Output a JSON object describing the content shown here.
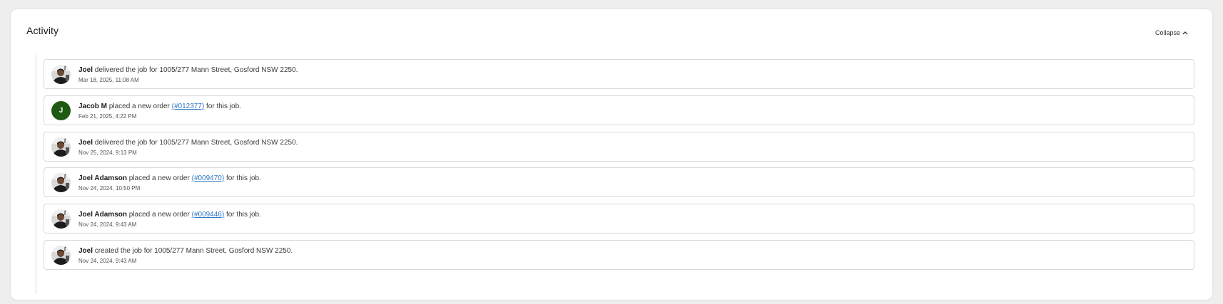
{
  "activity": {
    "title": "Activity",
    "collapse_label": "Collapse",
    "items": [
      {
        "actor": "Joel",
        "avatar_type": "photo",
        "action": "delivered the job for 1005/277 Mann Street, Gosford NSW 2250.",
        "link": "",
        "suffix": "",
        "timestamp": "Mar 18, 2025, 11:08 AM"
      },
      {
        "actor": "Jacob M",
        "avatar_type": "initial",
        "avatar_initial": "J",
        "avatar_color": "#1e5a12",
        "action": "placed a new order",
        "link": "(#012377)",
        "suffix": "for this job.",
        "timestamp": "Feb 21, 2025, 4:22 PM"
      },
      {
        "actor": "Joel",
        "avatar_type": "photo",
        "action": "delivered the job for 1005/277 Mann Street, Gosford NSW 2250.",
        "link": "",
        "suffix": "",
        "timestamp": "Nov 25, 2024, 9:13 PM"
      },
      {
        "actor": "Joel Adamson",
        "avatar_type": "photo",
        "action": "placed a new order",
        "link": "(#009470)",
        "suffix": "for this job.",
        "timestamp": "Nov 24, 2024, 10:50 PM"
      },
      {
        "actor": "Joel Adamson",
        "avatar_type": "photo",
        "action": "placed a new order",
        "link": "(#009446)",
        "suffix": "for this job.",
        "timestamp": "Nov 24, 2024, 9:43 AM"
      },
      {
        "actor": "Joel",
        "avatar_type": "photo",
        "action": "created the job for 1005/277 Mann Street, Gosford NSW 2250.",
        "link": "",
        "suffix": "",
        "timestamp": "Nov 24, 2024, 9:43 AM"
      }
    ]
  },
  "colors": {
    "link": "#2f78c4",
    "avatar_initial_bg": "#1e5a12"
  }
}
